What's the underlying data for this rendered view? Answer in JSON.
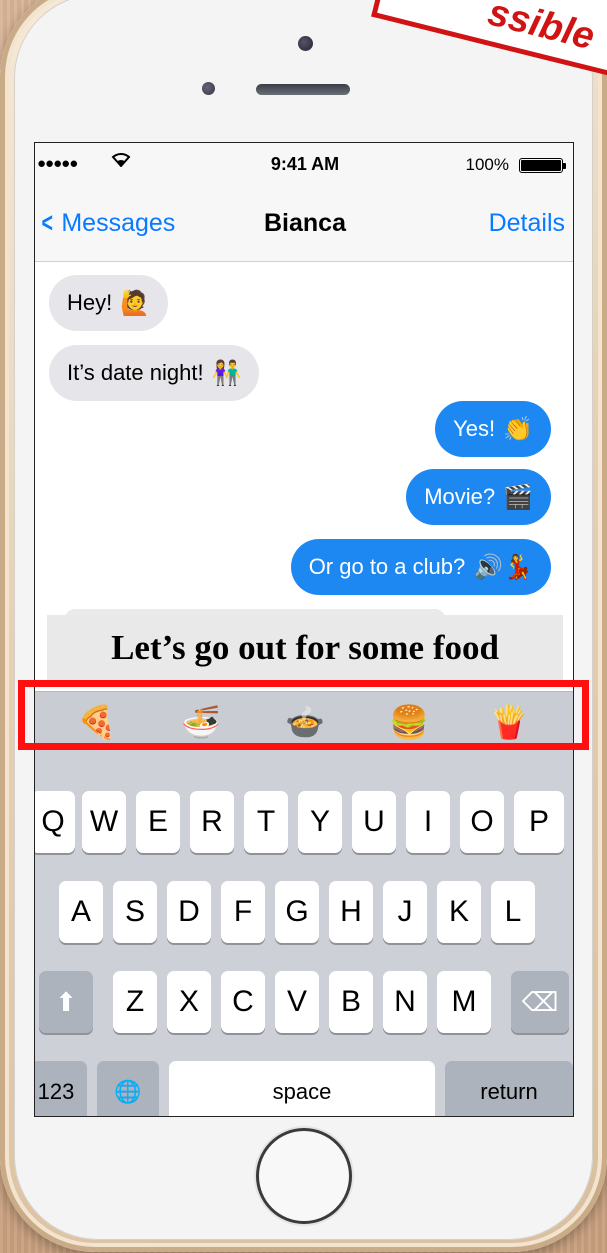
{
  "status": {
    "signal": "●●●●●",
    "time": "9:41 AM",
    "battery": "100%"
  },
  "nav": {
    "back_label": "Messages",
    "title": "Bianca",
    "details_label": "Details"
  },
  "messages": [
    {
      "from": "contact",
      "text": "Hey!",
      "emoji": "🙋"
    },
    {
      "from": "contact",
      "text": "It’s date night!",
      "emoji": "👫"
    },
    {
      "from": "me",
      "text": "Yes!",
      "emoji": "👏"
    },
    {
      "from": "me",
      "text": "Movie?",
      "emoji": "🎬"
    },
    {
      "from": "me",
      "text": "Or go to a club?",
      "emoji": "🔊💃"
    }
  ],
  "compose_text": "Let’s go out for some food",
  "emoji_suggestions": [
    "🍕",
    "🍜",
    "🍲",
    "🍔",
    "🍟"
  ],
  "keyboard": {
    "row1": [
      "Q",
      "W",
      "E",
      "R",
      "T",
      "Y",
      "U",
      "I",
      "O",
      "P"
    ],
    "row2": [
      "A",
      "S",
      "D",
      "F",
      "G",
      "H",
      "J",
      "K",
      "L"
    ],
    "row3": [
      "Z",
      "X",
      "C",
      "V",
      "B",
      "N",
      "M"
    ],
    "shift": "⬆",
    "delete": "⌫",
    "numbers": "123",
    "globe": "🌐",
    "space": "space",
    "return": "return"
  },
  "banner_text": "ssible",
  "colors": {
    "accent": "#0a7aff",
    "outgoing_bubble": "#1e88f2",
    "incoming_bubble": "#e5e5ea",
    "highlight": "#ff1010"
  }
}
